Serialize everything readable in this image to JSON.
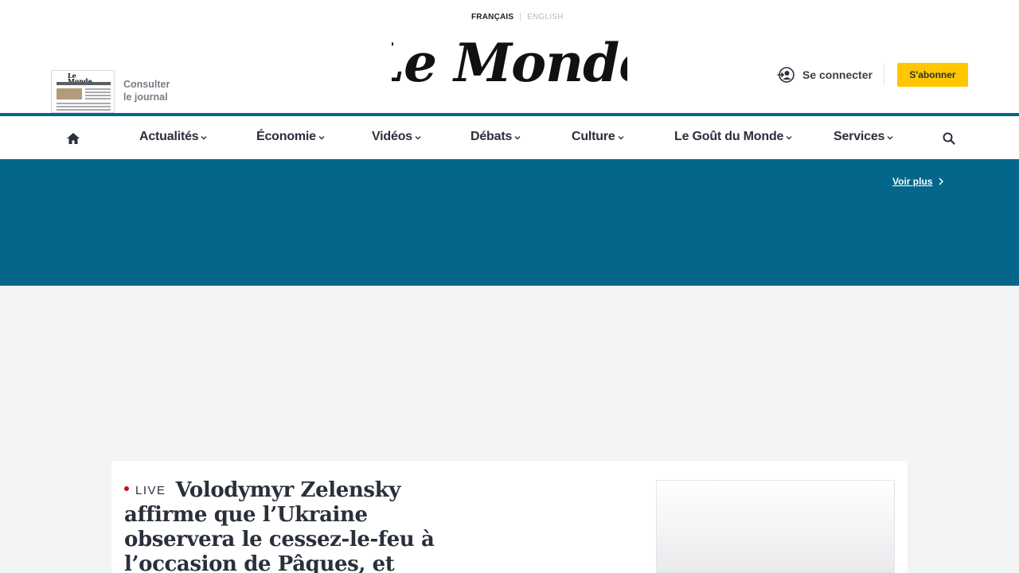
{
  "header": {
    "lang_fr": "FRANÇAIS",
    "lang_en": "ENGLISH",
    "logo_text": "Le Monde",
    "journal_label": "Consulter le journal",
    "journal_thumb_title": "Le Monde",
    "connect_label": "Se connecter",
    "subscribe_label": "S'abonner"
  },
  "nav": {
    "items": [
      {
        "label": "Actualités"
      },
      {
        "label": "Économie"
      },
      {
        "label": "Vidéos"
      },
      {
        "label": "Débats"
      },
      {
        "label": "Culture"
      },
      {
        "label": "Le Goût du Monde"
      },
      {
        "label": "Services"
      }
    ]
  },
  "banner": {
    "voir_plus": "Voir plus"
  },
  "article": {
    "live_label": "LIVE",
    "headline": "Volodymyr Zelensky affirme que l’Ukraine observera le cessez-le-feu à l’occasion de Pâques, et accuse"
  },
  "colors": {
    "brand_blue": "#03668a",
    "subscribe_yellow": "#ffc700",
    "live_red": "#c1121f"
  }
}
